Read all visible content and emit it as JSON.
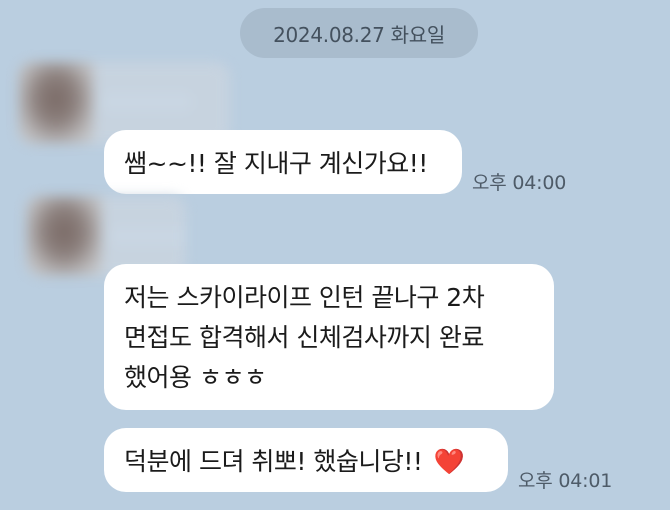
{
  "date_divider": "2024.08.27 화요일",
  "messages": [
    {
      "text": "쌤~~!! 잘 지내구 계신가요!!",
      "time": "오후 04:00"
    },
    {
      "lines": [
        "저는 스카이라이프 인턴 끝나구 2차",
        "면접도 합격해서 신체검사까지 완료",
        "했어용 ㅎㅎㅎ"
      ]
    },
    {
      "text": "덕분에 드뎌 취뽀! 했숩니당!!",
      "emoji": "❤️",
      "time": "오후 04:01"
    }
  ],
  "colors": {
    "background": "#bacee0",
    "bubble": "#ffffff",
    "date_pill": "#a9bccd",
    "heart": "#e1251b"
  }
}
